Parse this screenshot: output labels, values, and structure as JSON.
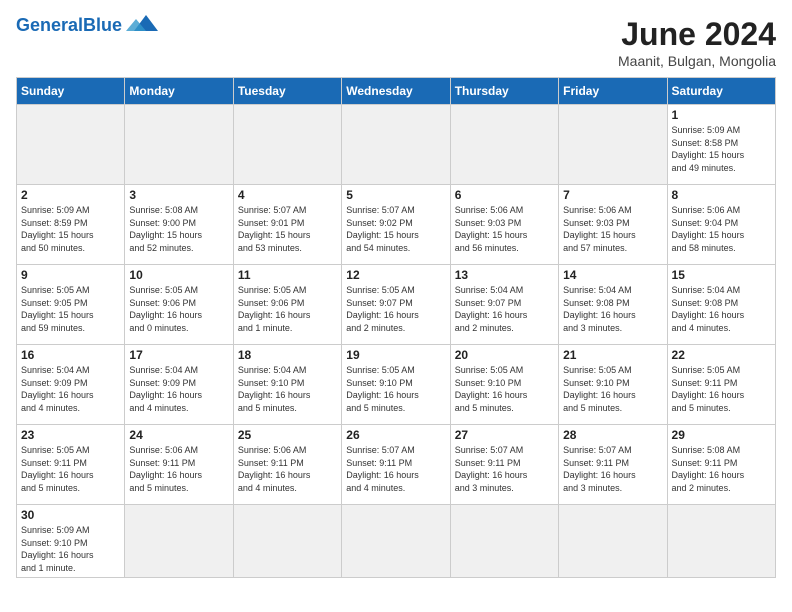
{
  "header": {
    "logo_general": "General",
    "logo_blue": "Blue",
    "title": "June 2024",
    "subtitle": "Maanit, Bulgan, Mongolia"
  },
  "weekdays": [
    "Sunday",
    "Monday",
    "Tuesday",
    "Wednesday",
    "Thursday",
    "Friday",
    "Saturday"
  ],
  "days": [
    {
      "date": "",
      "info": ""
    },
    {
      "date": "",
      "info": ""
    },
    {
      "date": "",
      "info": ""
    },
    {
      "date": "",
      "info": ""
    },
    {
      "date": "",
      "info": ""
    },
    {
      "date": "",
      "info": ""
    },
    {
      "date": "1",
      "info": "Sunrise: 5:09 AM\nSunset: 8:58 PM\nDaylight: 15 hours\nand 49 minutes."
    },
    {
      "date": "2",
      "info": "Sunrise: 5:09 AM\nSunset: 8:59 PM\nDaylight: 15 hours\nand 50 minutes."
    },
    {
      "date": "3",
      "info": "Sunrise: 5:08 AM\nSunset: 9:00 PM\nDaylight: 15 hours\nand 52 minutes."
    },
    {
      "date": "4",
      "info": "Sunrise: 5:07 AM\nSunset: 9:01 PM\nDaylight: 15 hours\nand 53 minutes."
    },
    {
      "date": "5",
      "info": "Sunrise: 5:07 AM\nSunset: 9:02 PM\nDaylight: 15 hours\nand 54 minutes."
    },
    {
      "date": "6",
      "info": "Sunrise: 5:06 AM\nSunset: 9:03 PM\nDaylight: 15 hours\nand 56 minutes."
    },
    {
      "date": "7",
      "info": "Sunrise: 5:06 AM\nSunset: 9:03 PM\nDaylight: 15 hours\nand 57 minutes."
    },
    {
      "date": "8",
      "info": "Sunrise: 5:06 AM\nSunset: 9:04 PM\nDaylight: 15 hours\nand 58 minutes."
    },
    {
      "date": "9",
      "info": "Sunrise: 5:05 AM\nSunset: 9:05 PM\nDaylight: 15 hours\nand 59 minutes."
    },
    {
      "date": "10",
      "info": "Sunrise: 5:05 AM\nSunset: 9:06 PM\nDaylight: 16 hours\nand 0 minutes."
    },
    {
      "date": "11",
      "info": "Sunrise: 5:05 AM\nSunset: 9:06 PM\nDaylight: 16 hours\nand 1 minute."
    },
    {
      "date": "12",
      "info": "Sunrise: 5:05 AM\nSunset: 9:07 PM\nDaylight: 16 hours\nand 2 minutes."
    },
    {
      "date": "13",
      "info": "Sunrise: 5:04 AM\nSunset: 9:07 PM\nDaylight: 16 hours\nand 2 minutes."
    },
    {
      "date": "14",
      "info": "Sunrise: 5:04 AM\nSunset: 9:08 PM\nDaylight: 16 hours\nand 3 minutes."
    },
    {
      "date": "15",
      "info": "Sunrise: 5:04 AM\nSunset: 9:08 PM\nDaylight: 16 hours\nand 4 minutes."
    },
    {
      "date": "16",
      "info": "Sunrise: 5:04 AM\nSunset: 9:09 PM\nDaylight: 16 hours\nand 4 minutes."
    },
    {
      "date": "17",
      "info": "Sunrise: 5:04 AM\nSunset: 9:09 PM\nDaylight: 16 hours\nand 4 minutes."
    },
    {
      "date": "18",
      "info": "Sunrise: 5:04 AM\nSunset: 9:10 PM\nDaylight: 16 hours\nand 5 minutes."
    },
    {
      "date": "19",
      "info": "Sunrise: 5:05 AM\nSunset: 9:10 PM\nDaylight: 16 hours\nand 5 minutes."
    },
    {
      "date": "20",
      "info": "Sunrise: 5:05 AM\nSunset: 9:10 PM\nDaylight: 16 hours\nand 5 minutes."
    },
    {
      "date": "21",
      "info": "Sunrise: 5:05 AM\nSunset: 9:10 PM\nDaylight: 16 hours\nand 5 minutes."
    },
    {
      "date": "22",
      "info": "Sunrise: 5:05 AM\nSunset: 9:11 PM\nDaylight: 16 hours\nand 5 minutes."
    },
    {
      "date": "23",
      "info": "Sunrise: 5:05 AM\nSunset: 9:11 PM\nDaylight: 16 hours\nand 5 minutes."
    },
    {
      "date": "24",
      "info": "Sunrise: 5:06 AM\nSunset: 9:11 PM\nDaylight: 16 hours\nand 5 minutes."
    },
    {
      "date": "25",
      "info": "Sunrise: 5:06 AM\nSunset: 9:11 PM\nDaylight: 16 hours\nand 4 minutes."
    },
    {
      "date": "26",
      "info": "Sunrise: 5:07 AM\nSunset: 9:11 PM\nDaylight: 16 hours\nand 4 minutes."
    },
    {
      "date": "27",
      "info": "Sunrise: 5:07 AM\nSunset: 9:11 PM\nDaylight: 16 hours\nand 3 minutes."
    },
    {
      "date": "28",
      "info": "Sunrise: 5:07 AM\nSunset: 9:11 PM\nDaylight: 16 hours\nand 3 minutes."
    },
    {
      "date": "29",
      "info": "Sunrise: 5:08 AM\nSunset: 9:11 PM\nDaylight: 16 hours\nand 2 minutes."
    },
    {
      "date": "30",
      "info": "Sunrise: 5:09 AM\nSunset: 9:10 PM\nDaylight: 16 hours\nand 1 minute."
    },
    {
      "date": "",
      "info": ""
    },
    {
      "date": "",
      "info": ""
    },
    {
      "date": "",
      "info": ""
    },
    {
      "date": "",
      "info": ""
    },
    {
      "date": "",
      "info": ""
    },
    {
      "date": "",
      "info": ""
    }
  ]
}
